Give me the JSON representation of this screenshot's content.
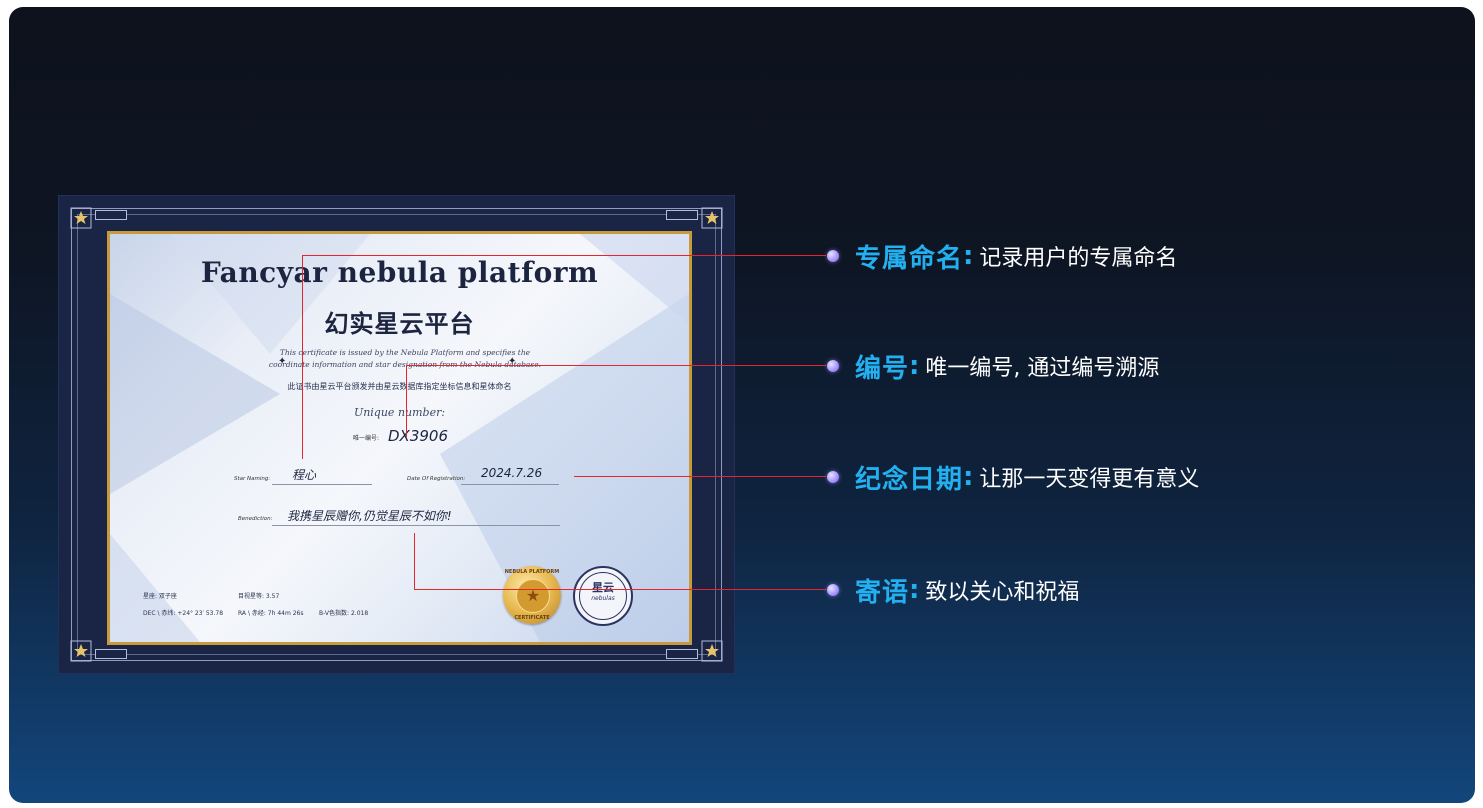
{
  "certificate": {
    "title_en": "Fancyar nebula platform",
    "title_cn": "幻实星云平台",
    "script_text": "This certificate is issued by the Nebula Platform and specifies the coordinate information and star designation from the Nebula database.",
    "description": "此证书由星云平台颁发并由星云数据库指定坐标信息和星体命名",
    "unique_script": "Unique number:",
    "uid_label": "唯一编号:",
    "uid_value": "DX3906",
    "star_naming_label": "Star Naming:",
    "star_name": "程心",
    "date_label": "Date Of Registration:",
    "date_value": "2024.7.26",
    "benediction_label": "Benediction:",
    "benediction_value": "我携星辰赠你,仍觉星辰不如你!",
    "constellation": "星座: 双子座",
    "magnitude": "目视星等: 3.57",
    "dec": "DEC \\ 赤纬: +24° 23′ 53.78",
    "ra": "RA \\ 赤经: 7h 44m 26s",
    "bv": "B-V色指数: 2.018",
    "seal_gold_top": "NEBULA PLATFORM",
    "seal_gold_bottom": "CERTIFICATE",
    "seal_blue_cn": "星云",
    "seal_blue_en": "nebulas"
  },
  "annotations": [
    {
      "title": "专属命名",
      "colon": ":",
      "desc": "记录用户的专属命名"
    },
    {
      "title": "编号",
      "colon": ":",
      "desc": "唯一编号, 通过编号溯源"
    },
    {
      "title": "纪念日期",
      "colon": ":",
      "desc": "让那一天变得更有意义"
    },
    {
      "title": "寄语",
      "colon": ":",
      "desc": "致以关心和祝福"
    }
  ],
  "colors": {
    "accent": "#22b0f0",
    "callout_line": "#e2272d",
    "frame": "#1a2546",
    "gold": "#c79a3c"
  }
}
